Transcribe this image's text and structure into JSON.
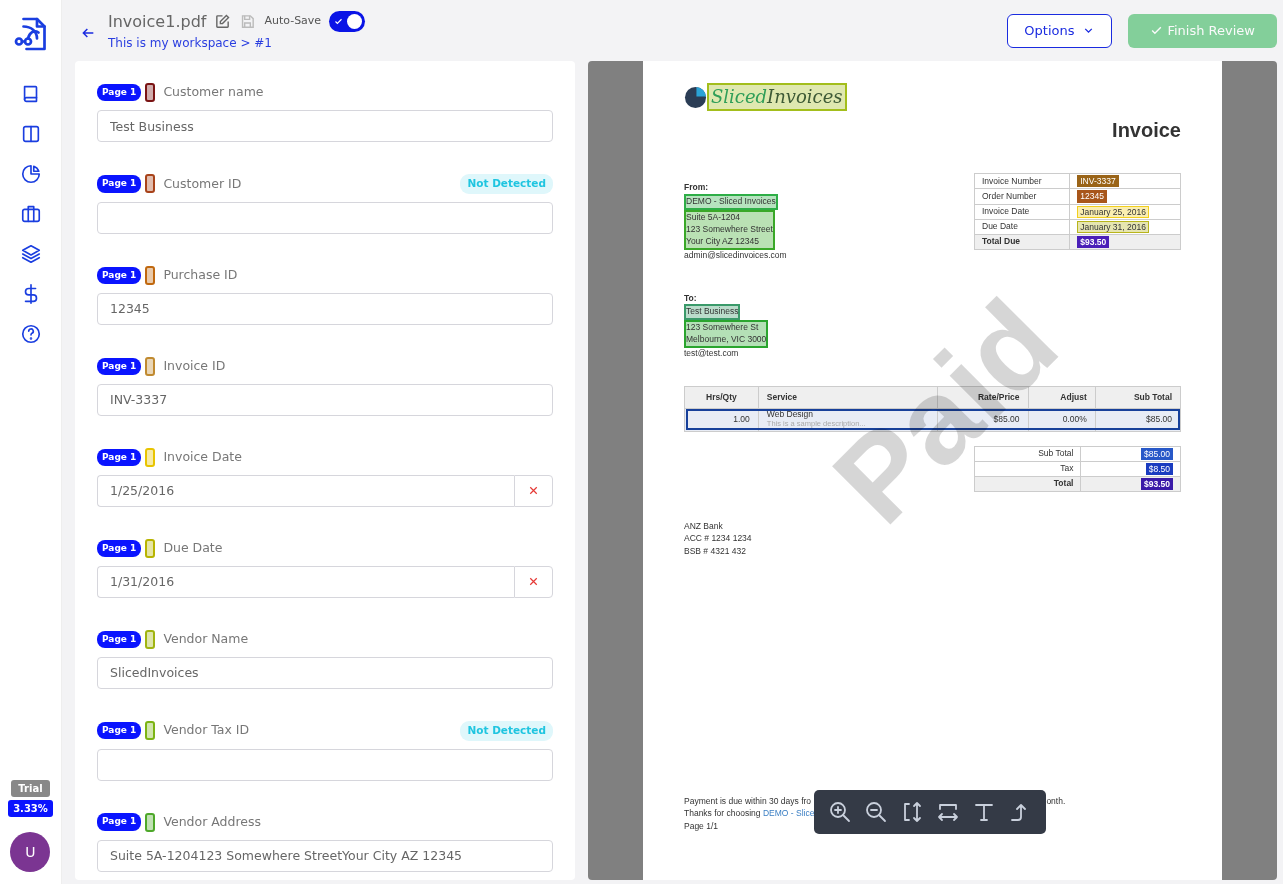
{
  "header": {
    "title": "Invoice1.pdf",
    "breadcrumb": "This is my workspace > #1",
    "autosave_label": "Auto-Save",
    "autosave_on": true,
    "options_label": "Options",
    "finish_label": "Finish Review",
    "finish_disabled": true
  },
  "sidebar": {
    "trial_label": "Trial",
    "usage": "3.33%",
    "avatar": "U"
  },
  "fields": [
    {
      "page": "Page 1",
      "color": "#7a1414",
      "label": "Customer name",
      "value": "Test Business",
      "clearable": false
    },
    {
      "page": "Page 1",
      "color": "#a8431a",
      "label": "Customer ID",
      "status": "Not Detected",
      "clearable": false
    },
    {
      "page": "Page 1",
      "color": "#c0680f",
      "label": "Purchase ID",
      "value": "12345",
      "clearable": false
    },
    {
      "page": "Page 1",
      "color": "#c08a30",
      "label": "Invoice ID",
      "value": "INV-3337",
      "clearable": false
    },
    {
      "page": "Page 1",
      "color": "#e8c400",
      "label": "Invoice Date",
      "value": "1/25/2016",
      "clearable": true
    },
    {
      "page": "Page 1",
      "color": "#b8b400",
      "label": "Due Date",
      "value": "1/31/2016",
      "clearable": true
    },
    {
      "page": "Page 1",
      "color": "#a0b410",
      "label": "Vendor Name",
      "value": "SlicedInvoices",
      "clearable": false
    },
    {
      "page": "Page 1",
      "color": "#7cb414",
      "label": "Vendor Tax ID",
      "status": "Not Detected",
      "clearable": false
    },
    {
      "page": "Page 1",
      "color": "#4ea82a",
      "label": "Vendor Address",
      "value": "Suite 5A-1204123 Somewhere StreetYour City AZ 12345",
      "clearable": false
    }
  ],
  "document": {
    "logo": {
      "part_1": "Sliced",
      "part_2": "Invoices",
      "color": "#a3be1c"
    },
    "heading": "Invoice",
    "from": {
      "label": "From:",
      "blocks": [
        {
          "lines": [
            "DEMO - Sliced Invoices"
          ],
          "color": "#2eae47"
        },
        {
          "lines": [
            "Suite 5A-1204",
            "123 Somewhere Street",
            "Your City AZ 12345"
          ],
          "color": "#3aa828"
        },
        {
          "lines": [
            "admin@slicedinvoices.com"
          ]
        }
      ]
    },
    "info": [
      {
        "kind": "row",
        "label": "Invoice Number",
        "value": "INV-3337",
        "color": "#9a6418",
        "solid": true
      },
      {
        "kind": "row",
        "label": "Order Number",
        "value": "12345",
        "color": "#a8561a",
        "solid": true
      },
      {
        "kind": "row",
        "label": "Invoice Date",
        "value": "January 25, 2016",
        "color": "#f2cf1e",
        "solid": false
      },
      {
        "kind": "row",
        "label": "Due Date",
        "value": "January 31, 2016",
        "color": "#b8b51c",
        "solid": false
      },
      {
        "kind": "total",
        "label": "Total Due",
        "value": "$93.50",
        "color": "#4a1fb8",
        "solid": true
      }
    ],
    "to": {
      "label": "To:",
      "blocks": [
        {
          "lines": [
            "Test Business"
          ],
          "color": "#3a9a6a"
        },
        {
          "lines": [
            "123 Somewhere St",
            "Melbourne, VIC 3000"
          ],
          "color": "#2aa52e"
        },
        {
          "lines": [
            "test@test.com"
          ]
        }
      ]
    },
    "items": {
      "columns": [
        "Hrs/Qty",
        "Service",
        "Rate/Price",
        "Adjust",
        "Sub Total"
      ],
      "rows": [
        {
          "qty": "1.00",
          "service": "Web Design",
          "description": "This is a sample description...",
          "rate": "$85.00",
          "adjust": "0.00%",
          "subtotal": "$85.00",
          "color": "#17409a"
        }
      ]
    },
    "totals": [
      {
        "kind": "row",
        "label": "Sub Total",
        "value": "$85.00",
        "color": "#2858c8",
        "solid": true
      },
      {
        "kind": "row",
        "label": "Tax",
        "value": "$8.50",
        "color": "#1a3cc0",
        "solid": true
      },
      {
        "kind": "total",
        "label": "Total",
        "value": "$93.50",
        "color": "#3a1aa8",
        "solid": true
      }
    ],
    "bank": [
      "ANZ Bank",
      "ACC # 1234 1234",
      "BSB # 4321 432"
    ],
    "footer": {
      "line_1": "Payment is due within 30 days fro",
      "line_1_end": "onth.",
      "line_2": "Thanks for choosing ",
      "line_2_link": "DEMO - Slice",
      "line_3": "Page 1/1"
    },
    "stamp": "Paid"
  }
}
